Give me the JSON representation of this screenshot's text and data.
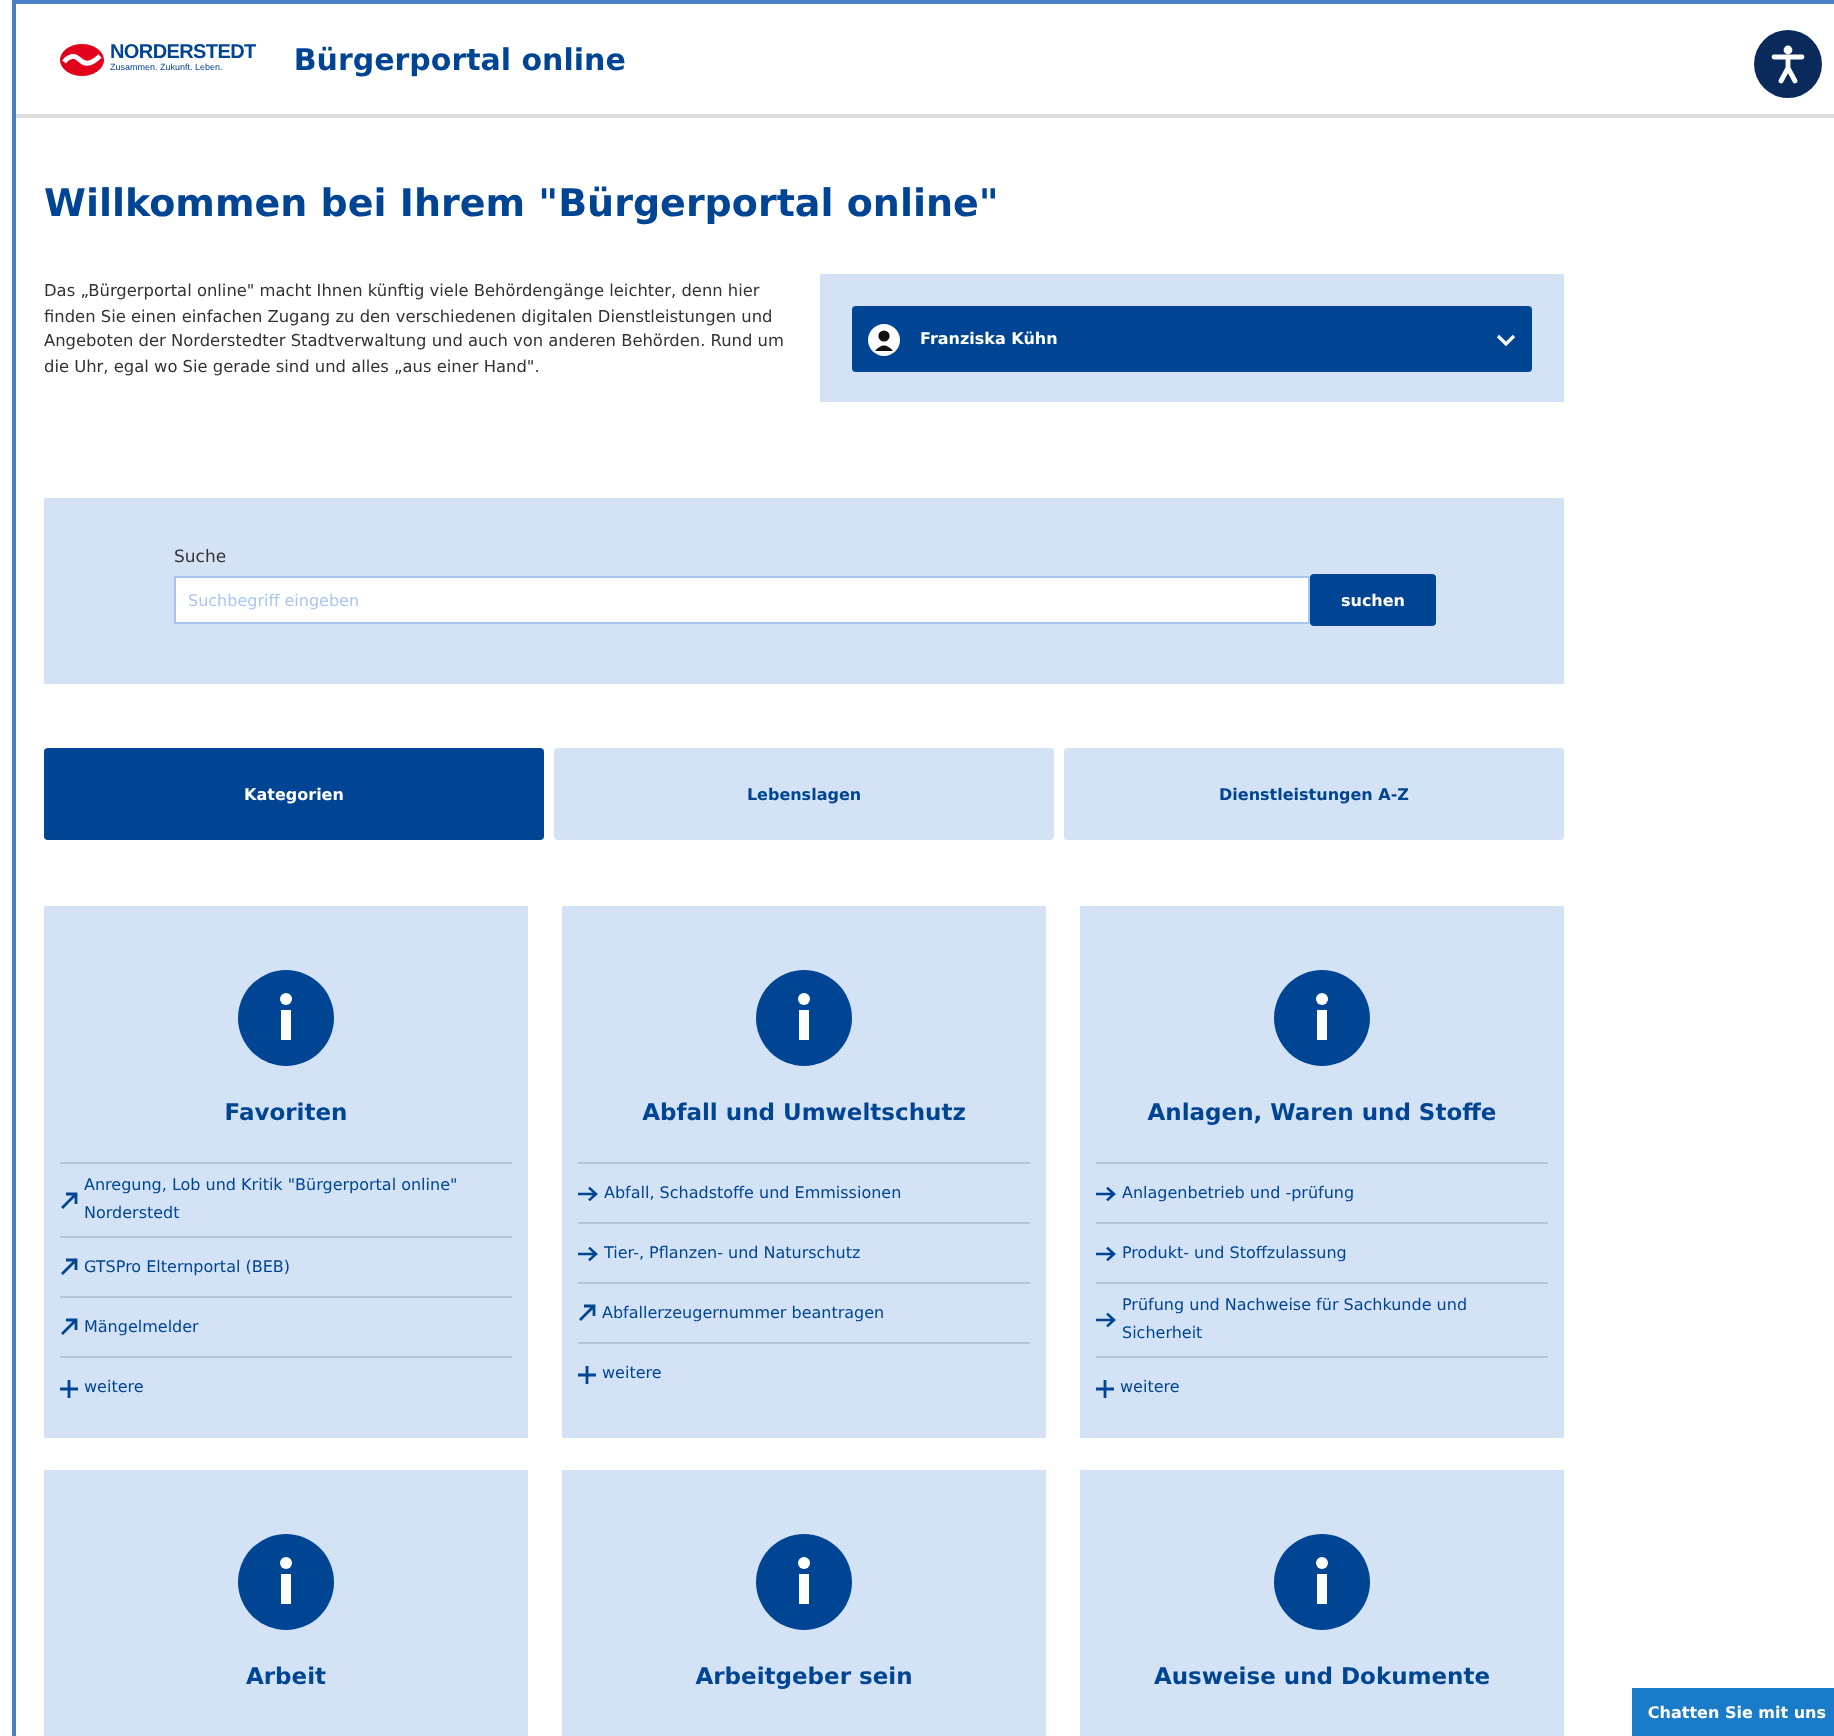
{
  "header": {
    "logo_name": "NORDERSTEDT",
    "logo_tagline": "Zusammen. Zukunft. Leben.",
    "title": "Bürgerportal online"
  },
  "welcome": {
    "heading": "Willkommen bei Ihrem \"Bürgerportal online\"",
    "intro": "Das „Bürgerportal online\" macht Ihnen künftig viele Behördengänge leichter, denn hier finden Sie einen einfachen Zugang zu den verschiedenen digitalen Dienstleistungen und Angeboten der Norderstedter Stadtverwaltung und auch von anderen Behörden. Rund um die Uhr, egal wo Sie gerade sind und alles „aus einer Hand\".",
    "user": "Franziska Kühn"
  },
  "search": {
    "label": "Suche",
    "placeholder": "Suchbegriff eingeben",
    "button": "suchen"
  },
  "tabs": [
    {
      "label": "Kategorien",
      "selected": true
    },
    {
      "label": "Lebenslagen",
      "selected": false
    },
    {
      "label": "Dienstleistungen A-Z",
      "selected": false
    }
  ],
  "categories": [
    {
      "title": "Favoriten",
      "links": [
        {
          "kind": "external",
          "text": "Anregung, Lob und Kritik \"Bürgerportal online\" Norderstedt"
        },
        {
          "kind": "external",
          "text": "GTSPro Elternportal (BEB)"
        },
        {
          "kind": "external",
          "text": "Mängelmelder"
        }
      ],
      "more": "weitere"
    },
    {
      "title": "Abfall und Umweltschutz",
      "links": [
        {
          "kind": "internal",
          "text": "Abfall, Schadstoffe und Emmissionen"
        },
        {
          "kind": "internal",
          "text": "Tier-, Pflanzen- und Naturschutz"
        },
        {
          "kind": "external",
          "text": "Abfallerzeugernummer beantragen"
        }
      ],
      "more": "weitere"
    },
    {
      "title": "Anlagen, Waren und Stoffe",
      "links": [
        {
          "kind": "internal",
          "text": "Anlagenbetrieb und -prüfung"
        },
        {
          "kind": "internal",
          "text": "Produkt- und Stoffzulassung"
        },
        {
          "kind": "internal",
          "text": "Prüfung und Nachweise für Sachkunde und Sicherheit"
        }
      ],
      "more": "weitere"
    },
    {
      "title": "Arbeit"
    },
    {
      "title": "Arbeitgeber sein"
    },
    {
      "title": "Ausweise und Dokumente"
    }
  ],
  "chat_button": "Chatten Sie mit uns"
}
